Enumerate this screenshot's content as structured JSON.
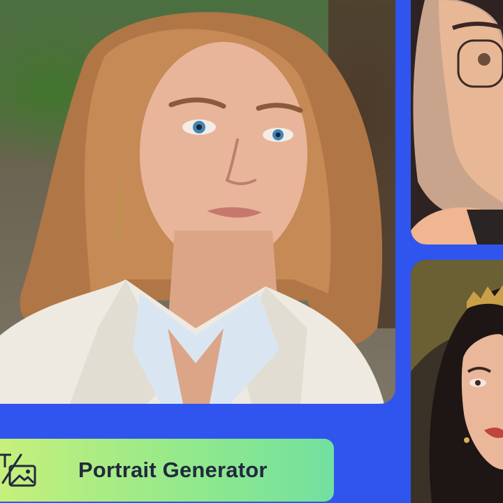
{
  "banner": {
    "title": "Portrait Generator",
    "icon": "text-to-image-icon",
    "background_start": "#c6f07b",
    "background_end": "#72e0a0",
    "text_color": "#232840"
  },
  "gallery": {
    "main_image": "realistic-portrait-woman-white-blazer",
    "top_right_image": "digital-art-woman-glasses",
    "bottom_right_image": "oil-painting-woman-crown"
  },
  "colors": {
    "background": "#2f55ee"
  }
}
